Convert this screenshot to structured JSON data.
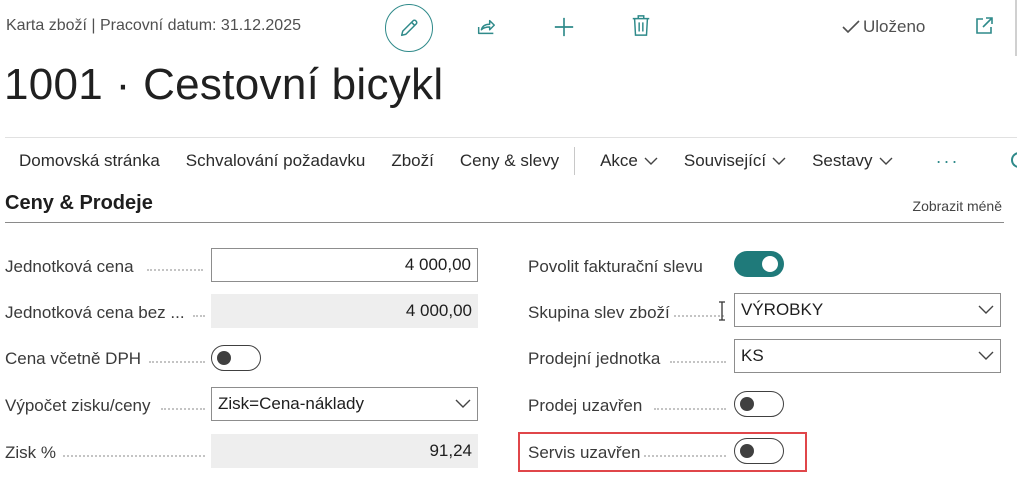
{
  "header": {
    "context_title": "Karta zboží | Pracovní datum: 31.12.2025",
    "saved_label": "Uloženo",
    "icons": [
      "pencil-icon",
      "share-icon",
      "plus-icon",
      "trash-icon",
      "checkmark-icon",
      "open-in-new-window-icon"
    ]
  },
  "page": {
    "title": "1001 · Cestovní bicykl"
  },
  "actions": {
    "home": "Domovská stránka",
    "approval": "Schvalování požadavku",
    "item": "Zboží",
    "prices": "Ceny & slevy",
    "actions_menu": "Akce",
    "related": "Související",
    "reports": "Sestavy",
    "more": "···"
  },
  "section": {
    "title": "Ceny & Prodeje",
    "show_less": "Zobrazit méně"
  },
  "left_fields": {
    "unit_price": {
      "label": "Jednotková cena",
      "value": "4 000,00"
    },
    "unit_price_excl": {
      "label": "Jednotková cena bez ...",
      "value": "4 000,00"
    },
    "price_incl_vat": {
      "label": "Cena včetně DPH",
      "toggle_on": false
    },
    "profit_calc": {
      "label": "Výpočet zisku/ceny",
      "value": "Zisk=Cena-náklady"
    },
    "profit_pct": {
      "label": "Zisk %",
      "value": "91,24"
    }
  },
  "right_fields": {
    "allow_invoice_disc": {
      "label": "Povolit fakturační slevu",
      "toggle_on": true
    },
    "item_disc_group": {
      "label": "Skupina slev zboží",
      "value": "VÝROBKY"
    },
    "sales_unit": {
      "label": "Prodejní jednotka",
      "value": "KS"
    },
    "sales_blocked": {
      "label": "Prodej uzavřen",
      "toggle_on": false
    },
    "service_blocked": {
      "label": "Servis uzavřen",
      "toggle_on": false
    }
  },
  "colors": {
    "accent": "#1f7a7a",
    "highlight": "#e0464a"
  }
}
